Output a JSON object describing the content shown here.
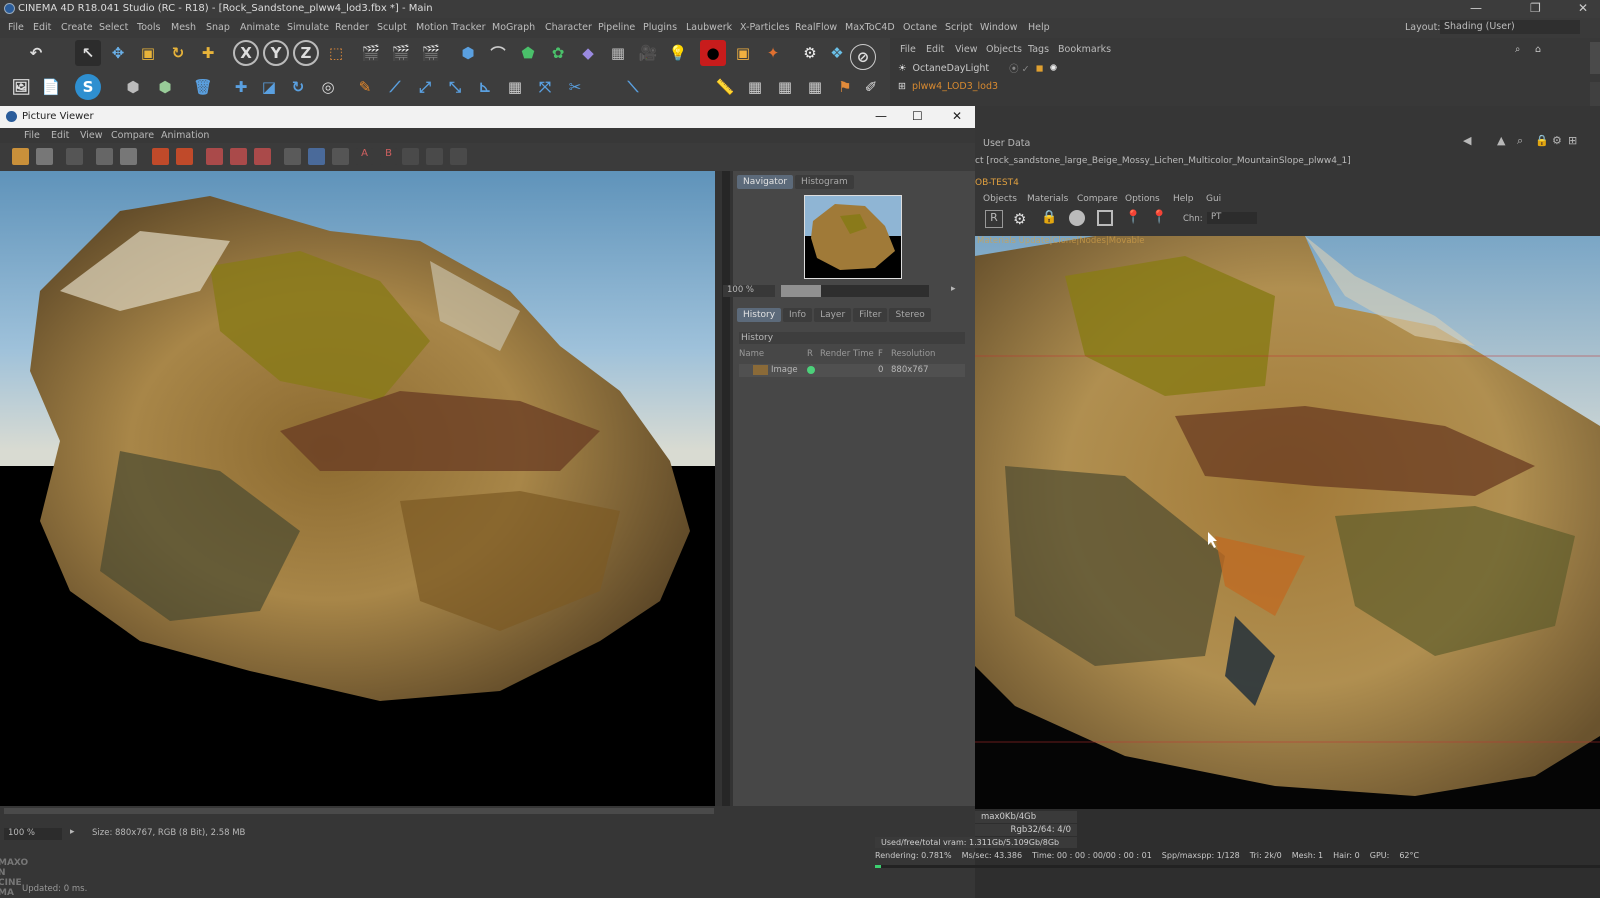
{
  "window": {
    "title": "CINEMA 4D R18.041 Studio (RC - R18) - [Rock_Sandstone_plww4_lod3.fbx *] - Main",
    "layout_label": "Layout:",
    "layout_value": "Shading (User)"
  },
  "menubar": [
    "File",
    "Edit",
    "Create",
    "Select",
    "Tools",
    "Mesh",
    "Snap",
    "Animate",
    "Simulate",
    "Render",
    "Sculpt",
    "Motion Tracker",
    "MoGraph",
    "Character",
    "Pipeline",
    "Plugins",
    "Laubwerk",
    "X-Particles",
    "RealFlow",
    "MaxToC4D",
    "Octane",
    "Script",
    "Window",
    "Help"
  ],
  "object_manager": {
    "menu": [
      "File",
      "Edit",
      "View",
      "Objects",
      "Tags",
      "Bookmarks"
    ],
    "objects": [
      "OctaneDayLight",
      "plww4_LOD3_lod3"
    ]
  },
  "picture_viewer": {
    "title": "Picture Viewer",
    "menu": [
      "File",
      "Edit",
      "View",
      "Compare",
      "Animation"
    ],
    "nav_tabs": [
      "Navigator",
      "Histogram"
    ],
    "zoom": "100 %",
    "history_tabs": [
      "History",
      "Info",
      "Layer",
      "Filter",
      "Stereo"
    ],
    "history_label": "History",
    "history_columns": [
      "Name",
      "R",
      "Render Time",
      "F",
      "Resolution"
    ],
    "history_rows": [
      {
        "name": "Image",
        "render_time": "",
        "frame": "0",
        "resolution": "880x767"
      }
    ],
    "status_zoom": "100 %",
    "status_info": "Size: 880x767, RGB (8 Bit), 2.58 MB",
    "updated": "Updated: 0 ms."
  },
  "attribute_manager": {
    "header": "User Data",
    "path": "ct [rock_sandstone_large_Beige_Mossy_Lichen_Multicolor_MountainSlope_plww4_1]"
  },
  "octane": {
    "label": "OB-TEST4",
    "menu": [
      "Objects",
      "Materials",
      "Compare",
      "Options",
      "Help",
      "Gui"
    ],
    "chn_label": "Chn:",
    "chn_value": "PT",
    "overlay_text": "Materials Update|Clone|Nodes|Movable",
    "stats": {
      "tex": "max0Kb/4Gb",
      "rgb": "Rgb32/64: 4/0",
      "vram": "Used/free/total vram: 1.311Gb/5.109Gb/8Gb",
      "rendering": "Rendering: 0.781%",
      "ms": "Ms/sec: 43.386",
      "time": "Time: 00 : 00 : 00/00 : 00 : 01",
      "spp": "Spp/maxspp: 1/128",
      "tri": "Tri: 2k/0",
      "mesh": "Mesh: 1",
      "hair": "Hair: 0",
      "gpu": "GPU:",
      "temp": "62°C",
      "progress": 0.0078
    }
  },
  "brand": "MAXON CINEMA"
}
